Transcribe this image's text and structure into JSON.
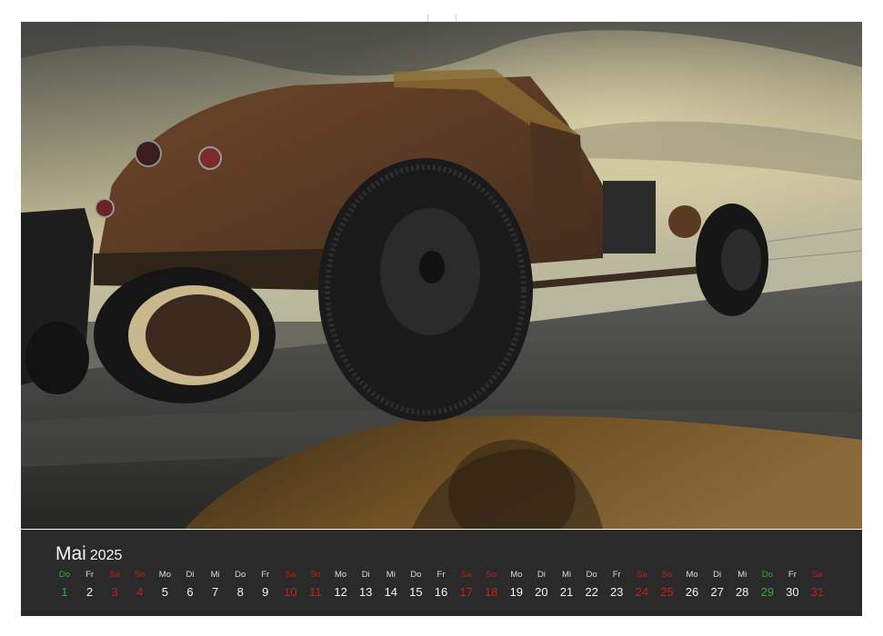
{
  "calendar": {
    "month": "Mai",
    "year": "2025",
    "days": [
      {
        "wd": "Do",
        "n": "1",
        "t": "hol"
      },
      {
        "wd": "Fr",
        "n": "2",
        "t": ""
      },
      {
        "wd": "Sa",
        "n": "3",
        "t": "we"
      },
      {
        "wd": "So",
        "n": "4",
        "t": "we"
      },
      {
        "wd": "Mo",
        "n": "5",
        "t": ""
      },
      {
        "wd": "Di",
        "n": "6",
        "t": ""
      },
      {
        "wd": "Mi",
        "n": "7",
        "t": ""
      },
      {
        "wd": "Do",
        "n": "8",
        "t": ""
      },
      {
        "wd": "Fr",
        "n": "9",
        "t": ""
      },
      {
        "wd": "Sa",
        "n": "10",
        "t": "we"
      },
      {
        "wd": "So",
        "n": "11",
        "t": "we"
      },
      {
        "wd": "Mo",
        "n": "12",
        "t": ""
      },
      {
        "wd": "Di",
        "n": "13",
        "t": ""
      },
      {
        "wd": "Mi",
        "n": "14",
        "t": ""
      },
      {
        "wd": "Do",
        "n": "15",
        "t": ""
      },
      {
        "wd": "Fr",
        "n": "16",
        "t": ""
      },
      {
        "wd": "Sa",
        "n": "17",
        "t": "we"
      },
      {
        "wd": "So",
        "n": "18",
        "t": "we"
      },
      {
        "wd": "Mo",
        "n": "19",
        "t": ""
      },
      {
        "wd": "Di",
        "n": "20",
        "t": ""
      },
      {
        "wd": "Mi",
        "n": "21",
        "t": ""
      },
      {
        "wd": "Do",
        "n": "22",
        "t": ""
      },
      {
        "wd": "Fr",
        "n": "23",
        "t": ""
      },
      {
        "wd": "Sa",
        "n": "24",
        "t": "we"
      },
      {
        "wd": "So",
        "n": "25",
        "t": "we"
      },
      {
        "wd": "Mo",
        "n": "26",
        "t": ""
      },
      {
        "wd": "Di",
        "n": "27",
        "t": ""
      },
      {
        "wd": "Mi",
        "n": "28",
        "t": ""
      },
      {
        "wd": "Do",
        "n": "29",
        "t": "hol"
      },
      {
        "wd": "Fr",
        "n": "30",
        "t": ""
      },
      {
        "wd": "Sa",
        "n": "31",
        "t": "we"
      }
    ]
  },
  "colors": {
    "weekend": "#c0211b",
    "holiday": "#3aa83a",
    "strip_background": "#2a2a2a"
  }
}
